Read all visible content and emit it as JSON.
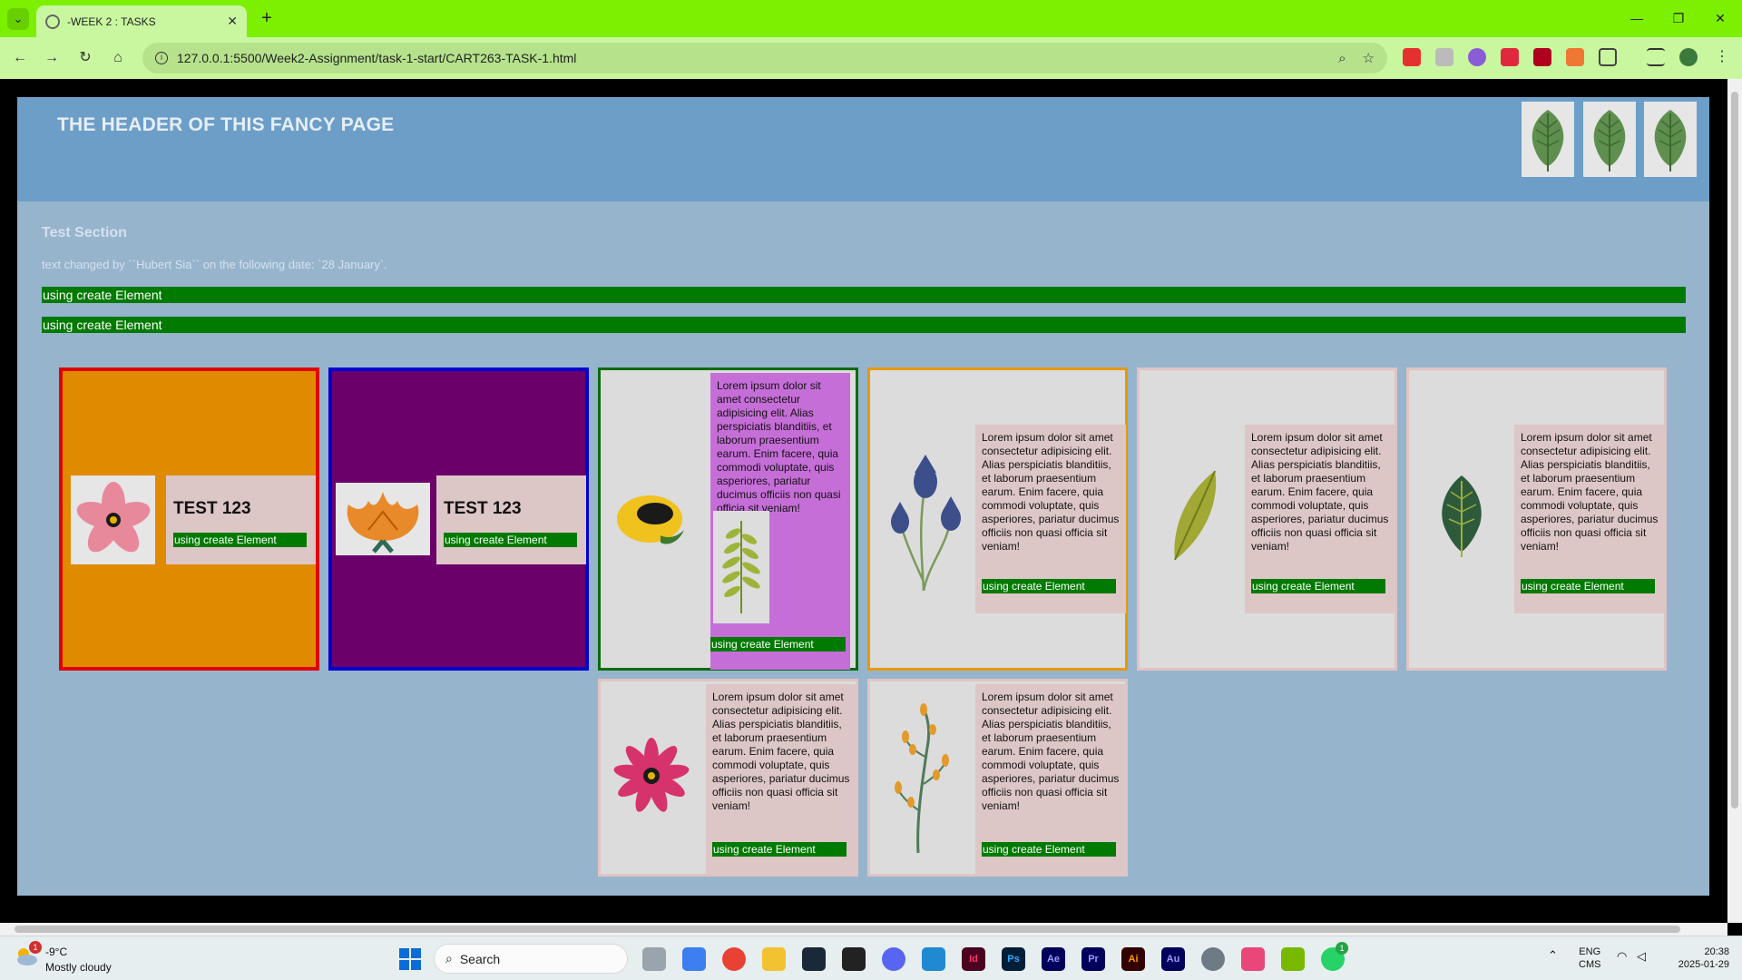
{
  "browser": {
    "tab_title": "-WEEK 2 : TASKS",
    "url": "127.0.0.1:5500/Week2-Assignment/task-1-start/CART263-TASK-1.html"
  },
  "page": {
    "header_title": "THE HEADER OF THIS FANCY PAGE",
    "section_title": "Test Section",
    "changed_text": "text changed by ``Hubert Sia`` on the following date: `28 January`.",
    "bar_label": "using create Element",
    "test_label": "TEST 123",
    "lorem": "Lorem ipsum dolor sit amet consectetur adipisicing elit. Alias perspiciatis blanditiis, et laborum praesentium earum. Enim facere, quia commodi voluptate, quis asperiores, pariatur ducimus officiis non quasi officia sit veniam!"
  },
  "taskbar": {
    "weather_temp": "-9°C",
    "weather_desc": "Mostly cloudy",
    "weather_badge": "1",
    "search_label": "Search",
    "lang_top": "ENG",
    "lang_bottom": "CMS",
    "time": "20:38",
    "date": "2025-01-29",
    "whatsapp_badge": "1",
    "apps": [
      "Id",
      "Ps",
      "Ae",
      "Pr",
      "Ai",
      "Au"
    ]
  },
  "colors": {
    "browser_frame": "#7cf000",
    "header_bg": "#6c9ec8",
    "page_bg": "#97b4cd",
    "green_bar": "#007a00"
  }
}
